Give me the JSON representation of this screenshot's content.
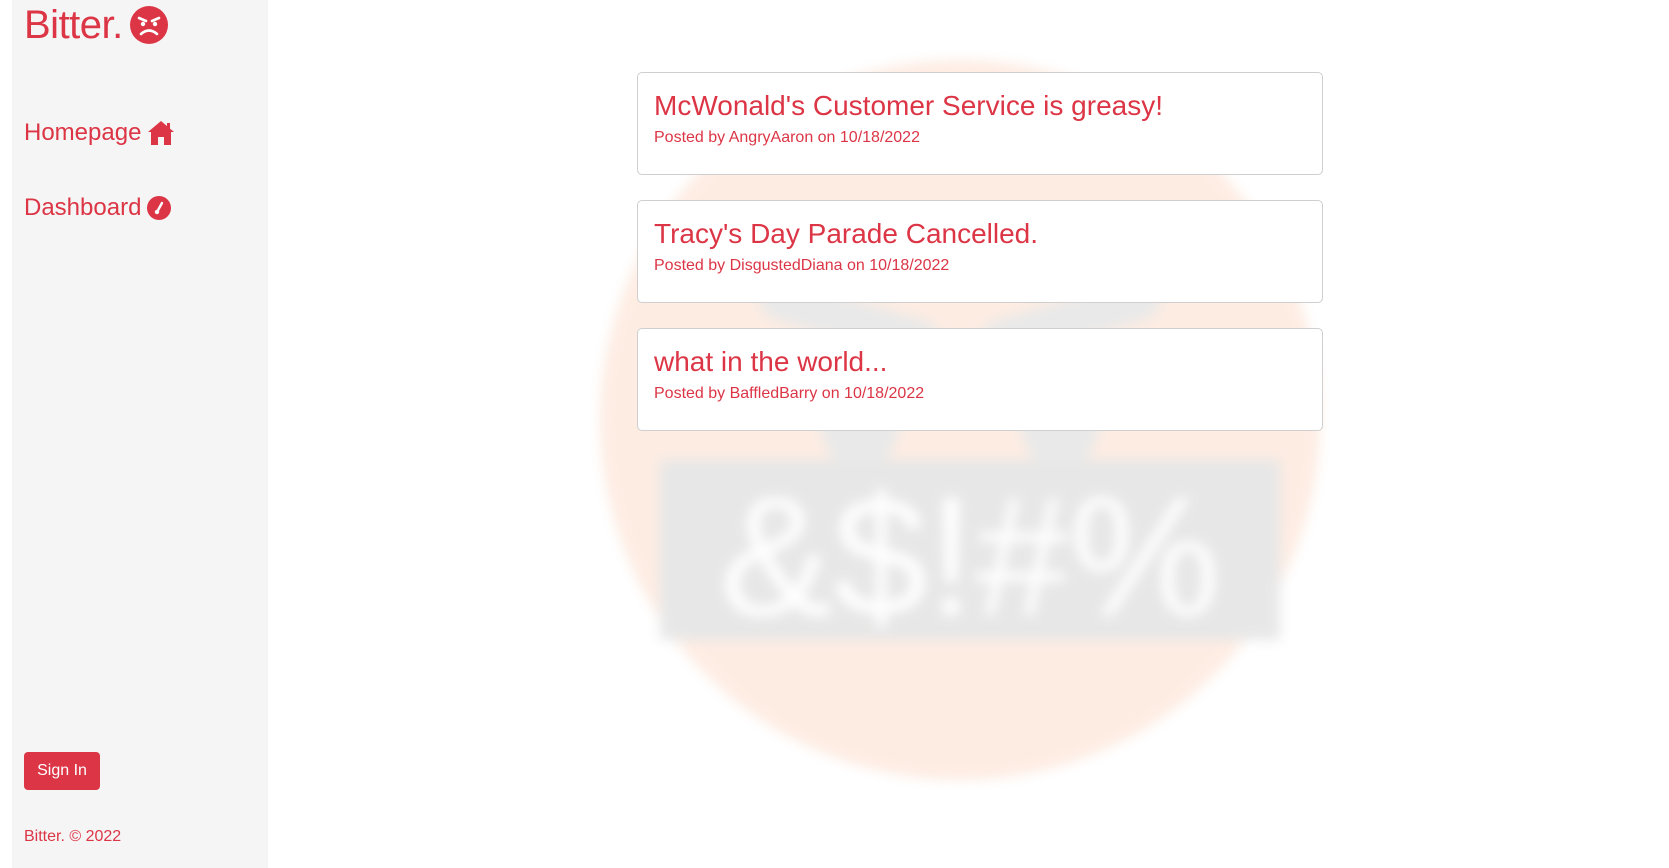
{
  "brand": {
    "name": "Bitter.",
    "icon": "angry-face-icon"
  },
  "nav": {
    "items": [
      {
        "label": "Homepage",
        "icon": "house-icon"
      },
      {
        "label": "Dashboard",
        "icon": "gauge-icon"
      }
    ]
  },
  "auth": {
    "signin_label": "Sign In"
  },
  "footer": {
    "text": "Bitter. © 2022"
  },
  "background": {
    "watermark_text": "&$!#%"
  },
  "posts": [
    {
      "title": "McWonald's Customer Service is greasy!",
      "meta": "Posted by AngryAaron on 10/18/2022"
    },
    {
      "title": "Tracy's Day Parade Cancelled.",
      "meta": "Posted by DisgustedDiana on 10/18/2022"
    },
    {
      "title": "what in the world...",
      "meta": "Posted by BaffledBarry on 10/18/2022"
    }
  ],
  "colors": {
    "accent": "#dc3545",
    "sidebar_bg": "#f5f5f5"
  }
}
